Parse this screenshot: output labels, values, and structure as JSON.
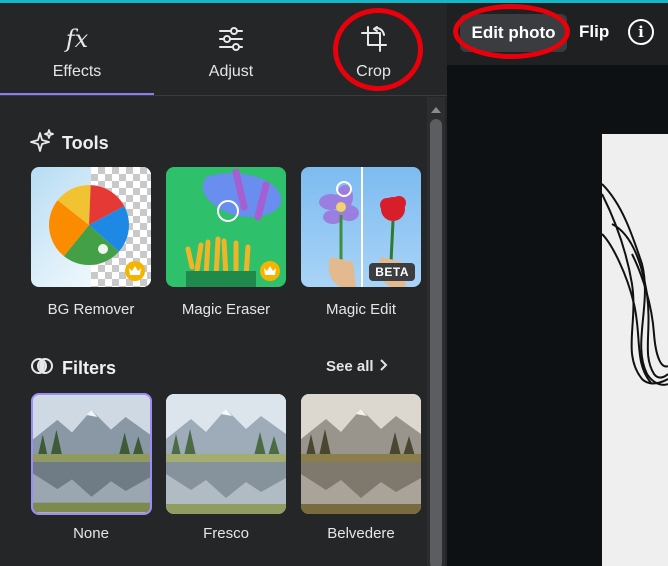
{
  "tabs": [
    {
      "label": "Effects",
      "icon": "fx-icon",
      "glyph": "fx",
      "active": true
    },
    {
      "label": "Adjust",
      "icon": "sliders-icon",
      "active": false
    },
    {
      "label": "Crop",
      "icon": "crop-icon",
      "active": false
    }
  ],
  "tools": {
    "title": "Tools",
    "items": [
      {
        "label": "BG Remover",
        "badge": "crown"
      },
      {
        "label": "Magic Eraser",
        "badge": "crown"
      },
      {
        "label": "Magic Edit",
        "badge": "BETA"
      }
    ]
  },
  "filters": {
    "title": "Filters",
    "see_all": "See all",
    "items": [
      {
        "label": "None",
        "selected": true
      },
      {
        "label": "Fresco",
        "selected": false
      },
      {
        "label": "Belvedere",
        "selected": false
      }
    ]
  },
  "toolbar": {
    "edit_photo": "Edit photo",
    "flip": "Flip",
    "info_glyph": "i"
  },
  "colors": {
    "accent": "#8b7cf6",
    "annotation": "#e8000b",
    "panel_bg": "#252627",
    "canvas_bg": "#0e1114",
    "top_strip": "#16b6c9",
    "premium_crown": "#f5b400"
  }
}
